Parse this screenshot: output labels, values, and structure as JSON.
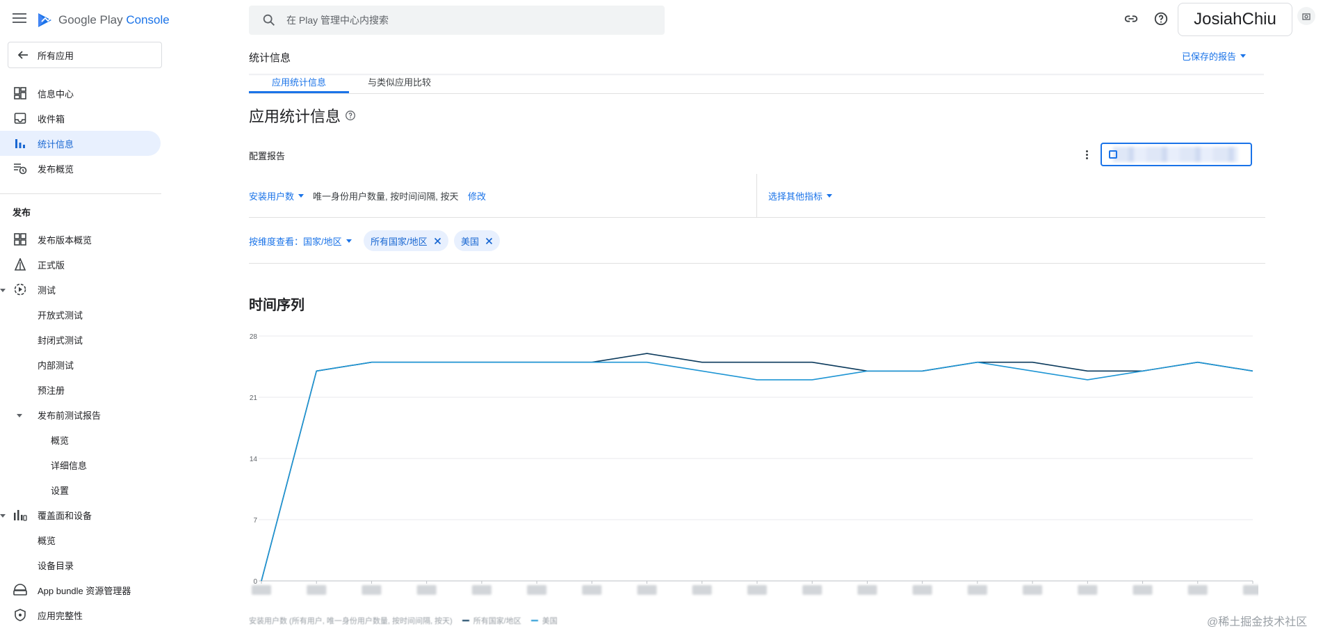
{
  "header": {
    "logo_brand": "Google Play",
    "logo_product": "Console",
    "search_placeholder": "在 Play 管理中心内搜索",
    "account_name": "JosiahChiu",
    "icons": [
      "menu-icon",
      "play-console-logo",
      "search-icon",
      "link-icon",
      "help-icon",
      "account-switch-icon"
    ]
  },
  "sidebar": {
    "back_label": "所有应用",
    "top_items": [
      {
        "label": "信息中心",
        "icon": "dashboard-icon"
      },
      {
        "label": "收件箱",
        "icon": "inbox-icon"
      },
      {
        "label": "统计信息",
        "icon": "bar-chart-icon",
        "active": true
      },
      {
        "label": "发布概览",
        "icon": "publishing-overview-icon"
      }
    ],
    "section_release": "发布",
    "release_items": [
      {
        "label": "发布版本概览",
        "icon": "releases-overview-icon"
      },
      {
        "label": "正式版",
        "icon": "production-icon"
      },
      {
        "label": "测试",
        "icon": "testing-icon"
      },
      {
        "label": "开放式测试"
      },
      {
        "label": "封闭式测试"
      },
      {
        "label": "内部测试"
      },
      {
        "label": "预注册"
      },
      {
        "label": "发布前测试报告"
      },
      {
        "label": "概览"
      },
      {
        "label": "详细信息"
      },
      {
        "label": "设置"
      },
      {
        "label": "覆盖面和设备",
        "icon": "reach-devices-icon"
      },
      {
        "label": "概览"
      },
      {
        "label": "设备目录"
      },
      {
        "label": "App bundle 资源管理器",
        "icon": "app-bundle-icon"
      },
      {
        "label": "应用完整性",
        "icon": "app-integrity-icon"
      }
    ]
  },
  "main": {
    "page_title": "统计信息",
    "saved_reports": "已保存的报告",
    "tabs": [
      "应用统计信息",
      "与类似应用比较"
    ],
    "heading": "应用统计信息",
    "config_label": "配置报告",
    "metric_name": "安装用户数",
    "metric_desc": "唯一身份用户数量, 按时间间隔, 按天",
    "edit_label": "修改",
    "other_metric": "选择其他指标",
    "dimension_label": "按维度查看：国家/地区",
    "chips": [
      "所有国家/地区",
      "美国"
    ],
    "chart_title": "时间序列",
    "legend_caption": "安装用户数 (所有用户, 唯一身份用户数量, 按时间间隔, 按天)",
    "watermark": "@稀土掘金技术社区"
  },
  "colors": {
    "accent": "#1a73e8",
    "series_all": "#0b3a5c",
    "series_us": "#1e95d4"
  },
  "chart_data": {
    "type": "line",
    "title": "时间序列",
    "xlabel": "",
    "ylabel": "",
    "ylim": [
      0,
      28
    ],
    "y_ticks": [
      0,
      7,
      14,
      21,
      28
    ],
    "x": [
      0,
      1,
      2,
      3,
      4,
      5,
      6,
      7,
      8,
      9,
      10,
      11,
      12,
      13,
      14,
      15,
      16,
      17,
      18
    ],
    "series": [
      {
        "name": "所有国家/地区",
        "color": "#0b3a5c",
        "values": [
          0,
          24,
          25,
          25,
          25,
          25,
          25,
          26,
          25,
          25,
          25,
          24,
          24,
          25,
          25,
          24,
          24,
          25,
          24
        ]
      },
      {
        "name": "美国",
        "color": "#1e95d4",
        "values": [
          0,
          24,
          25,
          25,
          25,
          25,
          25,
          25,
          24,
          23,
          23,
          24,
          24,
          25,
          24,
          23,
          24,
          25,
          24
        ]
      }
    ],
    "grid": true,
    "legend_position": "bottom-left"
  }
}
